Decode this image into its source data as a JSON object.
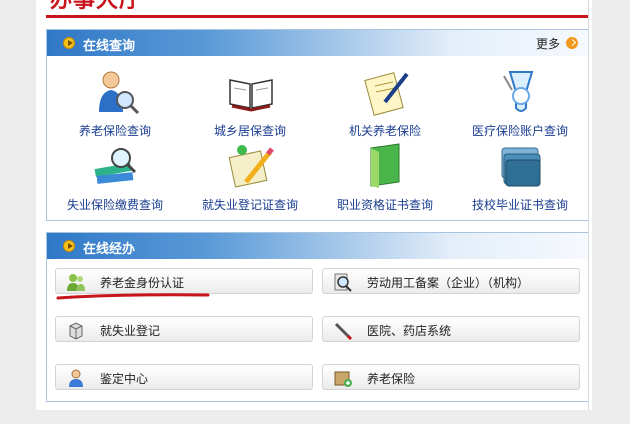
{
  "banner": {
    "title": "办事大厅"
  },
  "online_query": {
    "title": "在线查询",
    "more_label": "更多",
    "items": [
      {
        "label": "养老保险查询",
        "icon": "person-magnifier-icon"
      },
      {
        "label": "城乡居保查询",
        "icon": "open-book-icon"
      },
      {
        "label": "机关养老保险",
        "icon": "notepad-pen-icon"
      },
      {
        "label": "医疗保险账户查询",
        "icon": "medical-vial-icon"
      },
      {
        "label": "失业保险缴费查询",
        "icon": "books-magnifier-icon"
      },
      {
        "label": "就失业登记证查询",
        "icon": "certificate-pencil-icon"
      },
      {
        "label": "职业资格证书查询",
        "icon": "green-folder-icon"
      },
      {
        "label": "技校毕业证书查询",
        "icon": "folder-stack-icon"
      }
    ]
  },
  "online_services": {
    "title": "在线经办",
    "items": [
      {
        "label": "养老金身份认证",
        "icon": "users-icon"
      },
      {
        "label": "劳动用工备案（企业）（机构）",
        "icon": "search-document-icon"
      },
      {
        "label": "就失业登记",
        "icon": "cube-icon"
      },
      {
        "label": "医院、药店系统",
        "icon": "pen-icon"
      },
      {
        "label": "鉴定中心",
        "icon": "user-card-icon"
      },
      {
        "label": "养老保险",
        "icon": "box-add-icon"
      }
    ]
  },
  "colors": {
    "brand_red": "#c8141b",
    "link_blue": "#1a3d8f",
    "header_blue": "#2f78c6"
  }
}
